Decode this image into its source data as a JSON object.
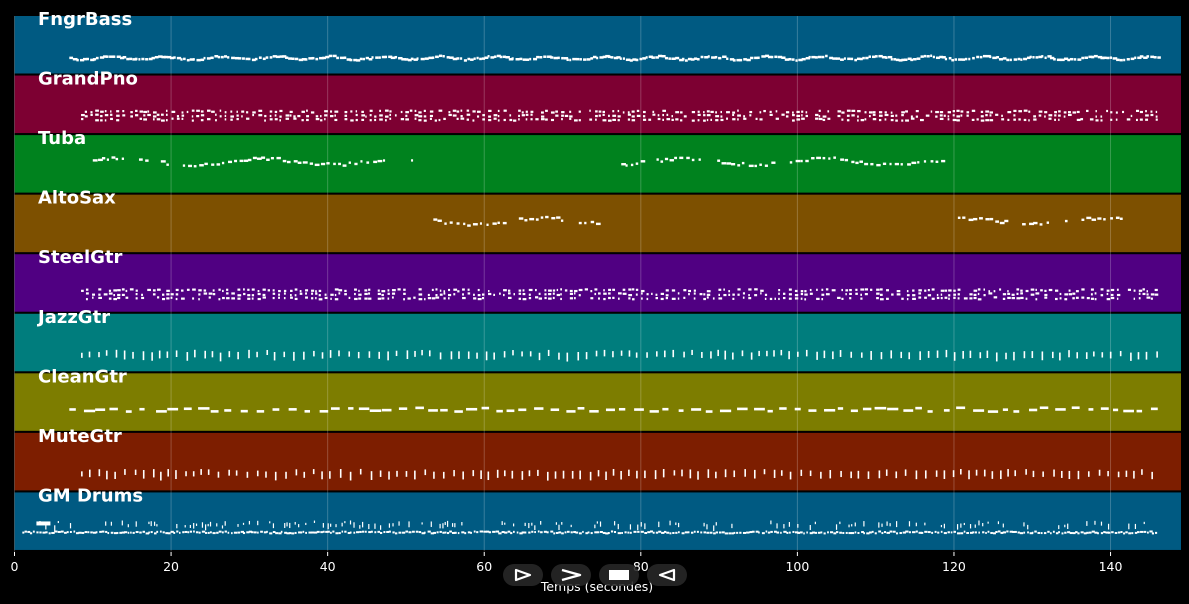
{
  "player": {
    "controls": [
      {
        "name": "play-button",
        "icon": "play-icon"
      },
      {
        "name": "next-button",
        "icon": "next-icon"
      },
      {
        "name": "stop-button",
        "icon": "stop-icon"
      },
      {
        "name": "previous-button",
        "icon": "previous-icon"
      }
    ]
  },
  "chart_data": {
    "type": "piano-roll",
    "title": "",
    "xlabel": "Temps (secondes)",
    "ylabel": "",
    "xlim": [
      0,
      149
    ],
    "xticks": [
      "0",
      "20",
      "40",
      "60",
      "80",
      "100",
      "120",
      "140"
    ],
    "grid": true,
    "tracks": [
      {
        "name": "FngrBass",
        "color": "#005a82",
        "start": 7,
        "end": 146,
        "style": "dense-line"
      },
      {
        "name": "GrandPno",
        "color": "#7d0032",
        "start": 8.5,
        "end": 146,
        "style": "dense-chords"
      },
      {
        "name": "Tuba",
        "color": "#00821e",
        "segments": [
          [
            8.5,
            51.5
          ],
          [
            76,
            118.5
          ]
        ],
        "style": "phrases"
      },
      {
        "name": "AltoSax",
        "color": "#7d5000",
        "segments": [
          [
            53.5,
            75
          ],
          [
            120.5,
            142
          ]
        ],
        "style": "phrases"
      },
      {
        "name": "SteelGtr",
        "color": "#500082",
        "start": 8.5,
        "end": 146,
        "style": "dense-chords"
      },
      {
        "name": "JazzGtr",
        "color": "#007d7d",
        "start": 8.5,
        "end": 146,
        "style": "sparse-chords"
      },
      {
        "name": "CleanGtr",
        "color": "#7d7d00",
        "start": 7,
        "end": 146,
        "style": "dashes"
      },
      {
        "name": "MuteGtr",
        "color": "#7d1e00",
        "start": 8.5,
        "end": 146,
        "style": "sparse-chords"
      },
      {
        "name": "GM Drums",
        "color": "#005a82",
        "start": 1,
        "end": 146,
        "style": "drums"
      }
    ]
  }
}
